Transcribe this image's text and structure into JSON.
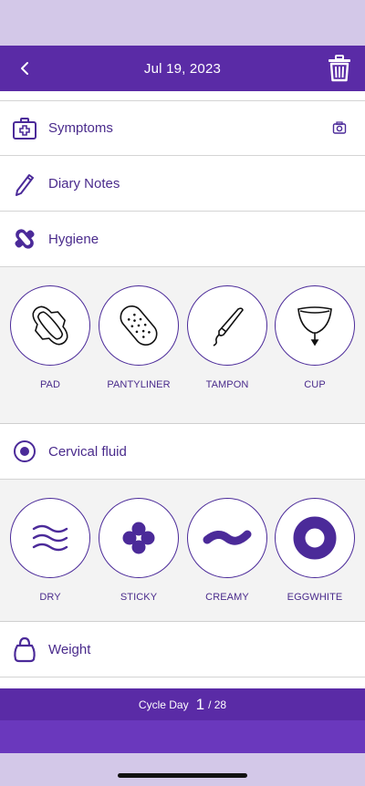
{
  "header": {
    "date": "Jul 19, 2023"
  },
  "rows": {
    "symptoms": {
      "label": "Symptoms"
    },
    "diary": {
      "label": "Diary Notes"
    },
    "hygiene": {
      "label": "Hygiene"
    },
    "cervical": {
      "label": "Cervical fluid"
    },
    "weight": {
      "label": "Weight"
    }
  },
  "hygiene_options": [
    {
      "label": "PAD",
      "icon": "pad-icon"
    },
    {
      "label": "PANTYLINER",
      "icon": "pantyliner-icon"
    },
    {
      "label": "TAMPON",
      "icon": "tampon-icon"
    },
    {
      "label": "CUP",
      "icon": "cup-icon"
    }
  ],
  "cervical_options": [
    {
      "label": "DRY",
      "icon": "dry-waves-icon"
    },
    {
      "label": "STICKY",
      "icon": "sticky-blob-icon"
    },
    {
      "label": "CREAMY",
      "icon": "creamy-wave-icon"
    },
    {
      "label": "EGGWHITE",
      "icon": "eggwhite-ring-icon"
    }
  ],
  "footer": {
    "prefix": "Cycle Day",
    "day": "1",
    "total": "/ 28"
  },
  "colors": {
    "primary": "#5a2ba6",
    "accent": "#4a2b8c",
    "status_bar": "#d3c8e8",
    "panel_bg": "#f3f3f3"
  }
}
